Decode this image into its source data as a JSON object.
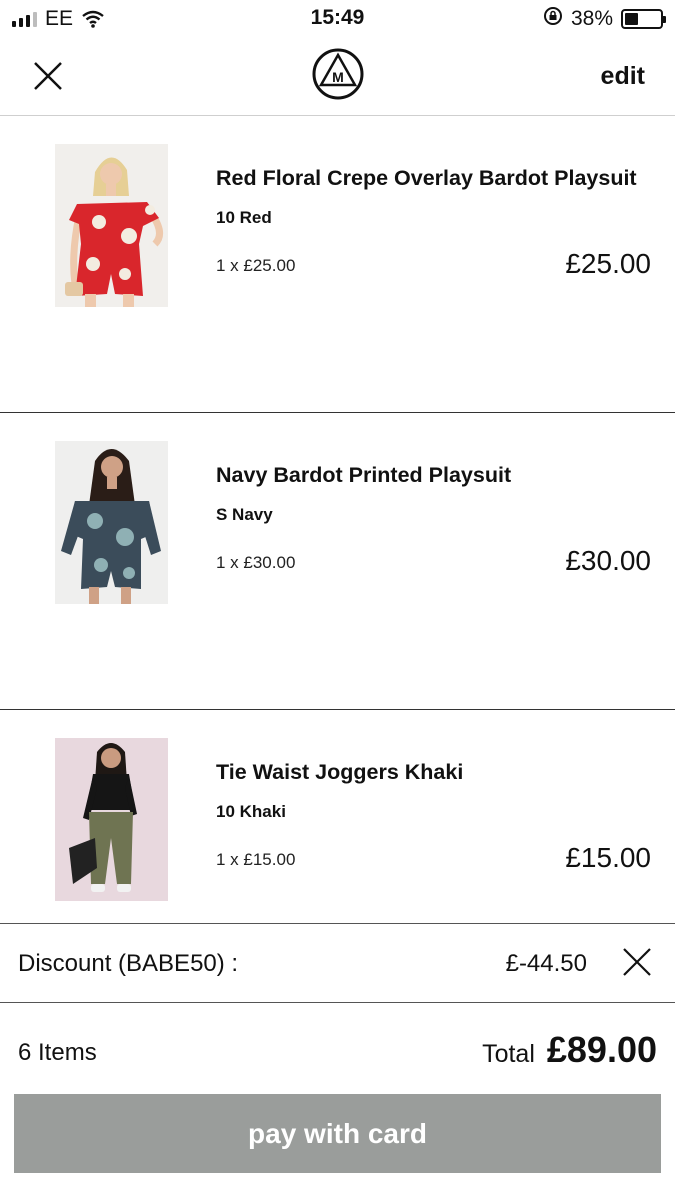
{
  "status_bar": {
    "carrier": "EE",
    "time": "15:49",
    "battery_percent": "38%",
    "battery_level": 0.38,
    "icons": [
      "signal-icon",
      "wifi-icon",
      "rotation-lock-icon",
      "battery-icon"
    ]
  },
  "nav": {
    "close_icon": "close-icon",
    "logo": "M",
    "edit_label": "edit"
  },
  "cart": {
    "items": [
      {
        "name": "Red Floral Crepe Overlay Bardot Playsuit",
        "variant": "10 Red",
        "qty_price": "1 x £25.00",
        "price": "£25.00"
      },
      {
        "name": "Navy Bardot Printed Playsuit",
        "variant": "S Navy",
        "qty_price": "1 x £30.00",
        "price": "£30.00"
      },
      {
        "name": "Tie Waist Joggers Khaki",
        "variant": "10 Khaki",
        "qty_price": "1 x £15.00",
        "price": "£15.00"
      }
    ]
  },
  "discount": {
    "label": "Discount (BABE50) :",
    "value": "£-44.50"
  },
  "summary": {
    "items_count": "6 Items",
    "total_label": "Total",
    "total_amount": "£89.00"
  },
  "pay_button": {
    "label": "pay with card"
  },
  "colors": {
    "pay_button_bg": "#9a9d9b",
    "text": "#111111",
    "divider": "#333333"
  }
}
